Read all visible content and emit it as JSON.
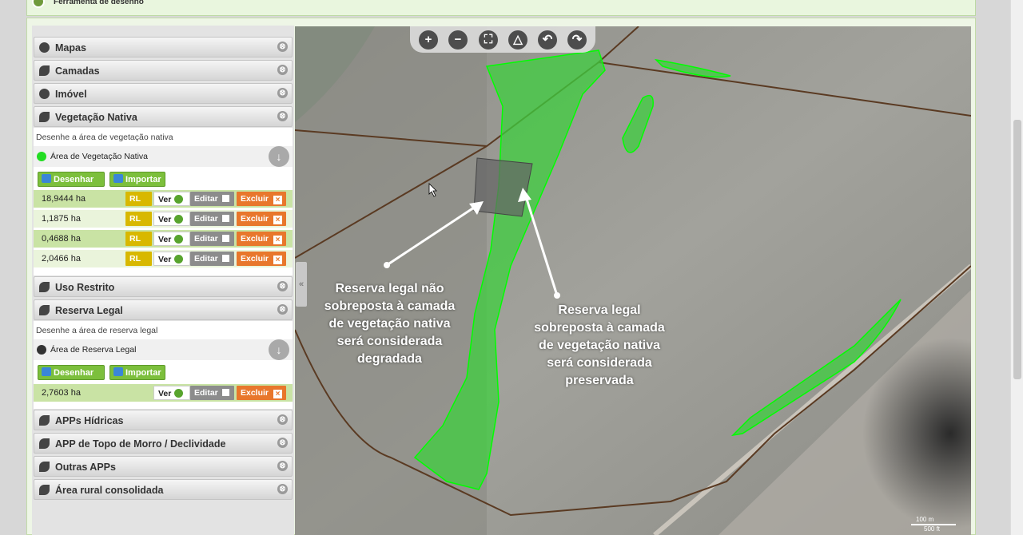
{
  "header": {
    "title": "Ferramenta de desenho"
  },
  "sidebar": {
    "sections": [
      {
        "label": "Mapas",
        "icon": "globe-icon"
      },
      {
        "label": "Camadas",
        "icon": "layers-icon"
      },
      {
        "label": "Imóvel",
        "icon": "globe-icon"
      },
      {
        "label": "Vegetação Nativa",
        "icon": "leaf-icon"
      },
      {
        "label": "Uso Restrito",
        "icon": "leaf-icon"
      },
      {
        "label": "Reserva Legal",
        "icon": "leaf-icon"
      },
      {
        "label": "APPs Hídricas",
        "icon": "leaf-icon"
      },
      {
        "label": "APP de Topo de Morro / Declividade",
        "icon": "leaf-icon"
      },
      {
        "label": "Outras APPs",
        "icon": "leaf-icon"
      },
      {
        "label": "Área rural consolidada",
        "icon": "leaf-icon"
      }
    ],
    "vegetacao": {
      "hint": "Desenhe a área de vegetação nativa",
      "legend": "Área de Vegetação Nativa",
      "legend_color": "#22dd22",
      "draw_label": "Desenhar",
      "import_label": "Importar",
      "rows": [
        {
          "area": "18,9444 ha",
          "rl": "RL",
          "ver": "Ver",
          "edit": "Editar",
          "del": "Excluir"
        },
        {
          "area": "1,1875 ha",
          "rl": "RL",
          "ver": "Ver",
          "edit": "Editar",
          "del": "Excluir"
        },
        {
          "area": "0,4688 ha",
          "rl": "RL",
          "ver": "Ver",
          "edit": "Editar",
          "del": "Excluir"
        },
        {
          "area": "2,0466 ha",
          "rl": "RL",
          "ver": "Ver",
          "edit": "Editar",
          "del": "Excluir"
        }
      ]
    },
    "reserva": {
      "hint": "Desenhe a área de reserva legal",
      "legend": "Área de Reserva Legal",
      "legend_color": "#333333",
      "draw_label": "Desenhar",
      "import_label": "Importar",
      "rows": [
        {
          "area": "2,7603 ha",
          "ver": "Ver",
          "edit": "Editar",
          "del": "Excluir"
        }
      ]
    },
    "close_glyph": "⊗",
    "delete_glyph": "×",
    "down_glyph": "↓",
    "collapse_glyph": "«"
  },
  "map": {
    "toolbar": [
      {
        "name": "zoom-in-icon",
        "glyph": "+"
      },
      {
        "name": "zoom-out-icon",
        "glyph": "−"
      },
      {
        "name": "fullscreen-icon",
        "glyph": "⛶"
      },
      {
        "name": "measure-icon",
        "glyph": "△"
      },
      {
        "name": "undo-icon",
        "glyph": "↶"
      },
      {
        "name": "redo-icon",
        "glyph": "↷"
      }
    ],
    "annotation_left": [
      "Reserva legal não",
      "sobreposta à camada",
      "de vegetação nativa",
      "será considerada",
      "degradada"
    ],
    "annotation_right": [
      "Reserva legal",
      "sobreposta à camada",
      "de vegetação nativa",
      "será considerada",
      "preservada"
    ],
    "scale_m": "100 m",
    "scale_ft": "500 ft",
    "colors": {
      "vegetation": "#3fcf3f",
      "outline": "#00ff00",
      "boundary": "#5a3a22"
    }
  }
}
